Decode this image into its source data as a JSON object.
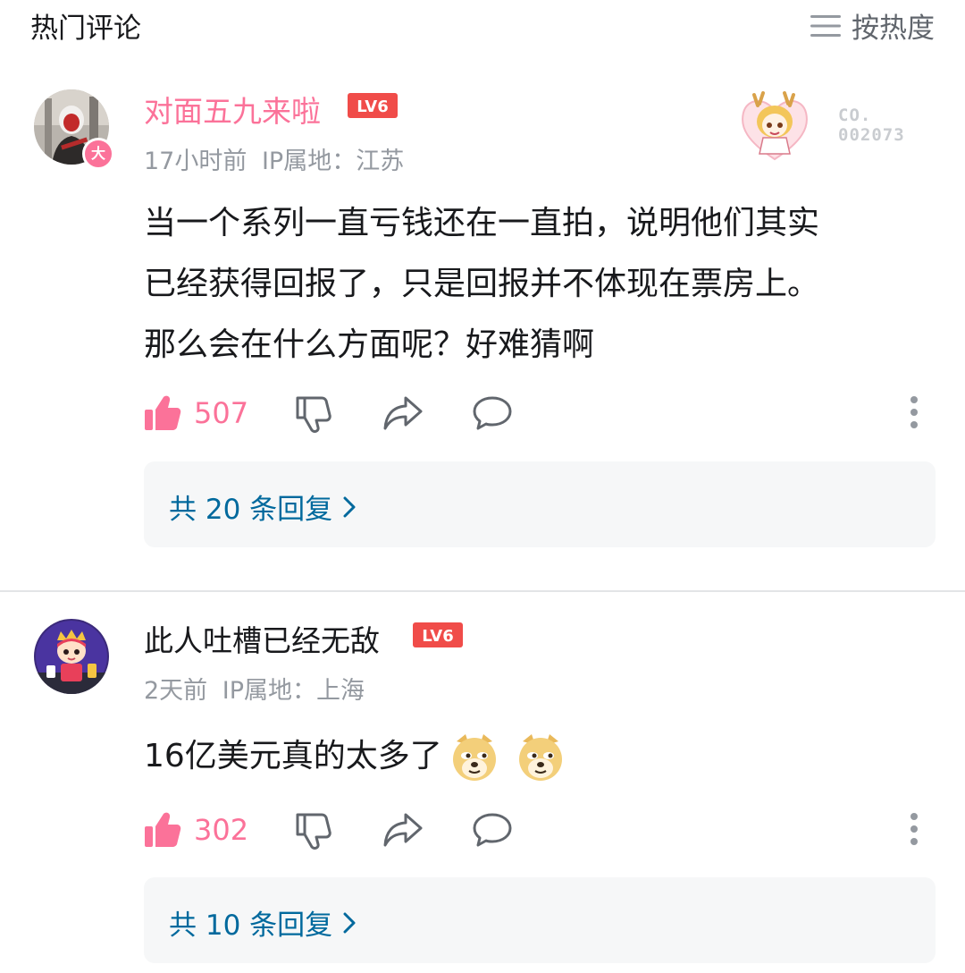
{
  "header": {
    "title": "热门评论",
    "sort_label": "按热度"
  },
  "comments": [
    {
      "username": "对面五九来啦",
      "level": "LV6",
      "avatar_badge": "大",
      "time": "17小时前",
      "ip": "IP属地：江苏",
      "fan_card_number": [
        "CO.",
        "002073"
      ],
      "content": [
        "当一个系列一直亏钱还在一直拍，说明他们其实",
        "已经获得回报了，只是回报并不体现在票房上。",
        "那么会在什么方面呢？好难猜啊"
      ],
      "likes": "507",
      "replies": "共 20 条回复"
    },
    {
      "username": "此人吐槽已经无敌",
      "level": "LV6",
      "time": "2天前",
      "ip": "IP属地：上海",
      "content_text": "16亿美元真的太多了",
      "emojis": [
        "doge-emoji",
        "doge-emoji"
      ],
      "likes": "302",
      "replies": "共 10 条回复"
    }
  ],
  "colors": {
    "accent": "#fb7299",
    "reply_link": "#00699d",
    "meta": "#9499a0",
    "level_badge": "#f04c49"
  }
}
